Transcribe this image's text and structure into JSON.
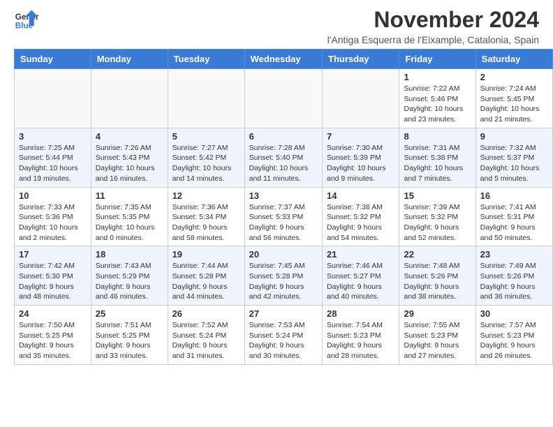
{
  "header": {
    "logo_general": "General",
    "logo_blue": "Blue",
    "month_title": "November 2024",
    "location": "l'Antiga Esquerra de l'Eixample, Catalonia, Spain"
  },
  "weekdays": [
    "Sunday",
    "Monday",
    "Tuesday",
    "Wednesday",
    "Thursday",
    "Friday",
    "Saturday"
  ],
  "weeks": [
    [
      {
        "day": "",
        "info": ""
      },
      {
        "day": "",
        "info": ""
      },
      {
        "day": "",
        "info": ""
      },
      {
        "day": "",
        "info": ""
      },
      {
        "day": "",
        "info": ""
      },
      {
        "day": "1",
        "info": "Sunrise: 7:22 AM\nSunset: 5:46 PM\nDaylight: 10 hours and 23 minutes."
      },
      {
        "day": "2",
        "info": "Sunrise: 7:24 AM\nSunset: 5:45 PM\nDaylight: 10 hours and 21 minutes."
      }
    ],
    [
      {
        "day": "3",
        "info": "Sunrise: 7:25 AM\nSunset: 5:44 PM\nDaylight: 10 hours and 19 minutes."
      },
      {
        "day": "4",
        "info": "Sunrise: 7:26 AM\nSunset: 5:43 PM\nDaylight: 10 hours and 16 minutes."
      },
      {
        "day": "5",
        "info": "Sunrise: 7:27 AM\nSunset: 5:42 PM\nDaylight: 10 hours and 14 minutes."
      },
      {
        "day": "6",
        "info": "Sunrise: 7:28 AM\nSunset: 5:40 PM\nDaylight: 10 hours and 11 minutes."
      },
      {
        "day": "7",
        "info": "Sunrise: 7:30 AM\nSunset: 5:39 PM\nDaylight: 10 hours and 9 minutes."
      },
      {
        "day": "8",
        "info": "Sunrise: 7:31 AM\nSunset: 5:38 PM\nDaylight: 10 hours and 7 minutes."
      },
      {
        "day": "9",
        "info": "Sunrise: 7:32 AM\nSunset: 5:37 PM\nDaylight: 10 hours and 5 minutes."
      }
    ],
    [
      {
        "day": "10",
        "info": "Sunrise: 7:33 AM\nSunset: 5:36 PM\nDaylight: 10 hours and 2 minutes."
      },
      {
        "day": "11",
        "info": "Sunrise: 7:35 AM\nSunset: 5:35 PM\nDaylight: 10 hours and 0 minutes."
      },
      {
        "day": "12",
        "info": "Sunrise: 7:36 AM\nSunset: 5:34 PM\nDaylight: 9 hours and 58 minutes."
      },
      {
        "day": "13",
        "info": "Sunrise: 7:37 AM\nSunset: 5:33 PM\nDaylight: 9 hours and 56 minutes."
      },
      {
        "day": "14",
        "info": "Sunrise: 7:38 AM\nSunset: 5:32 PM\nDaylight: 9 hours and 54 minutes."
      },
      {
        "day": "15",
        "info": "Sunrise: 7:39 AM\nSunset: 5:32 PM\nDaylight: 9 hours and 52 minutes."
      },
      {
        "day": "16",
        "info": "Sunrise: 7:41 AM\nSunset: 5:31 PM\nDaylight: 9 hours and 50 minutes."
      }
    ],
    [
      {
        "day": "17",
        "info": "Sunrise: 7:42 AM\nSunset: 5:30 PM\nDaylight: 9 hours and 48 minutes."
      },
      {
        "day": "18",
        "info": "Sunrise: 7:43 AM\nSunset: 5:29 PM\nDaylight: 9 hours and 46 minutes."
      },
      {
        "day": "19",
        "info": "Sunrise: 7:44 AM\nSunset: 5:28 PM\nDaylight: 9 hours and 44 minutes."
      },
      {
        "day": "20",
        "info": "Sunrise: 7:45 AM\nSunset: 5:28 PM\nDaylight: 9 hours and 42 minutes."
      },
      {
        "day": "21",
        "info": "Sunrise: 7:46 AM\nSunset: 5:27 PM\nDaylight: 9 hours and 40 minutes."
      },
      {
        "day": "22",
        "info": "Sunrise: 7:48 AM\nSunset: 5:26 PM\nDaylight: 9 hours and 38 minutes."
      },
      {
        "day": "23",
        "info": "Sunrise: 7:49 AM\nSunset: 5:26 PM\nDaylight: 9 hours and 36 minutes."
      }
    ],
    [
      {
        "day": "24",
        "info": "Sunrise: 7:50 AM\nSunset: 5:25 PM\nDaylight: 9 hours and 35 minutes."
      },
      {
        "day": "25",
        "info": "Sunrise: 7:51 AM\nSunset: 5:25 PM\nDaylight: 9 hours and 33 minutes."
      },
      {
        "day": "26",
        "info": "Sunrise: 7:52 AM\nSunset: 5:24 PM\nDaylight: 9 hours and 31 minutes."
      },
      {
        "day": "27",
        "info": "Sunrise: 7:53 AM\nSunset: 5:24 PM\nDaylight: 9 hours and 30 minutes."
      },
      {
        "day": "28",
        "info": "Sunrise: 7:54 AM\nSunset: 5:23 PM\nDaylight: 9 hours and 28 minutes."
      },
      {
        "day": "29",
        "info": "Sunrise: 7:55 AM\nSunset: 5:23 PM\nDaylight: 9 hours and 27 minutes."
      },
      {
        "day": "30",
        "info": "Sunrise: 7:57 AM\nSunset: 5:23 PM\nDaylight: 9 hours and 26 minutes."
      }
    ]
  ]
}
